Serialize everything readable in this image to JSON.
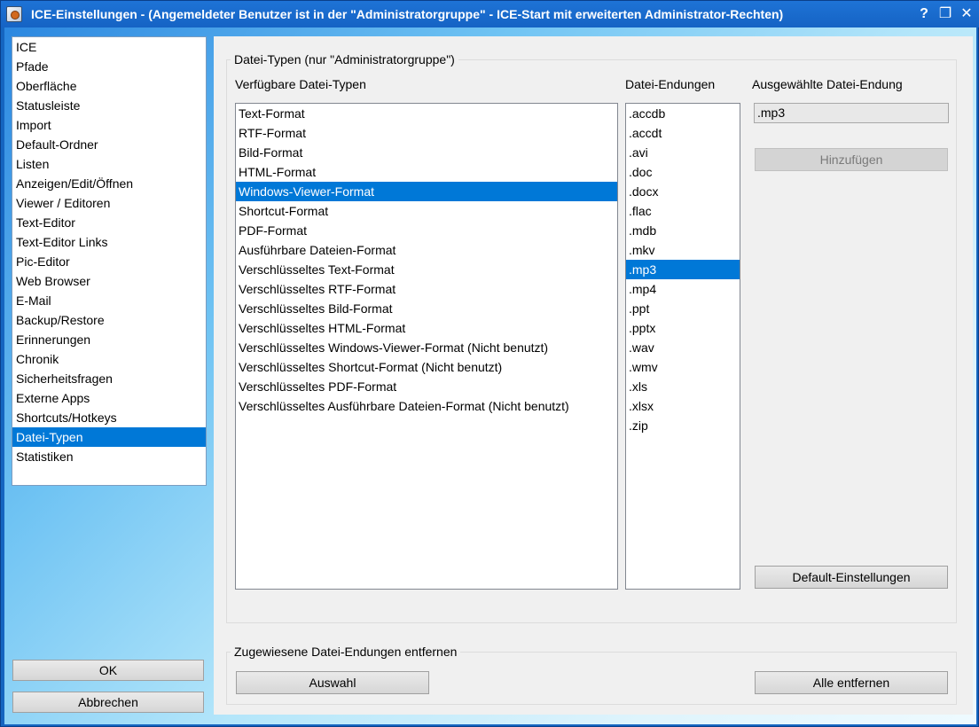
{
  "window": {
    "title": "ICE-Einstellungen - (Angemeldeter Benutzer ist in der \"Administratorgruppe\" - ICE-Start mit erweiterten Administrator-Rechten)",
    "help_glyph": "?",
    "restore_glyph": "❐",
    "close_glyph": "✕"
  },
  "sidebar": {
    "items": [
      {
        "label": "ICE"
      },
      {
        "label": "Pfade"
      },
      {
        "label": "Oberfläche"
      },
      {
        "label": "Statusleiste"
      },
      {
        "label": "Import"
      },
      {
        "label": "Default-Ordner"
      },
      {
        "label": "Listen"
      },
      {
        "label": "Anzeigen/Edit/Öffnen"
      },
      {
        "label": "Viewer / Editoren"
      },
      {
        "label": "Text-Editor"
      },
      {
        "label": "Text-Editor Links"
      },
      {
        "label": "Pic-Editor"
      },
      {
        "label": "Web Browser"
      },
      {
        "label": "E-Mail"
      },
      {
        "label": "Backup/Restore"
      },
      {
        "label": "Erinnerungen"
      },
      {
        "label": "Chronik"
      },
      {
        "label": "Sicherheitsfragen"
      },
      {
        "label": "Externe Apps"
      },
      {
        "label": "Shortcuts/Hotkeys"
      },
      {
        "label": "Datei-Typen"
      },
      {
        "label": "Statistiken"
      }
    ],
    "selected_label": "Datei-Typen",
    "ok_label": "OK",
    "cancel_label": "Abbrechen"
  },
  "file_types_group": {
    "title": "Datei-Typen (nur \"Administratorgruppe\")",
    "available_label": "Verfügbare Datei-Typen",
    "extensions_label": "Datei-Endungen",
    "selected_ext_label": "Ausgewählte Datei-Endung",
    "selected_ext_value": ".mp3",
    "add_label": "Hinzufügen",
    "default_label": "Default-Einstellungen",
    "types": [
      "Text-Format",
      "RTF-Format",
      "Bild-Format",
      "HTML-Format",
      "Windows-Viewer-Format",
      "Shortcut-Format",
      "PDF-Format",
      "Ausführbare Dateien-Format",
      "Verschlüsseltes Text-Format",
      "Verschlüsseltes RTF-Format",
      "Verschlüsseltes Bild-Format",
      "Verschlüsseltes HTML-Format",
      "Verschlüsseltes Windows-Viewer-Format (Nicht benutzt)",
      "Verschlüsseltes Shortcut-Format (Nicht benutzt)",
      "Verschlüsseltes PDF-Format",
      "Verschlüsseltes Ausführbare Dateien-Format (Nicht benutzt)"
    ],
    "selected_type": "Windows-Viewer-Format",
    "extensions": [
      ".accdb",
      ".accdt",
      ".avi",
      ".doc",
      ".docx",
      ".flac",
      ".mdb",
      ".mkv",
      ".mp3",
      ".mp4",
      ".ppt",
      ".pptx",
      ".wav",
      ".wmv",
      ".xls",
      ".xlsx",
      ".zip"
    ],
    "selected_extension": ".mp3"
  },
  "remove_group": {
    "title": "Zugewiesene Datei-Endungen entfernen",
    "selection_label": "Auswahl",
    "remove_all_label": "Alle entfernen"
  },
  "colors": {
    "selection": "#0078d7",
    "title_bar": "#1565c0"
  }
}
